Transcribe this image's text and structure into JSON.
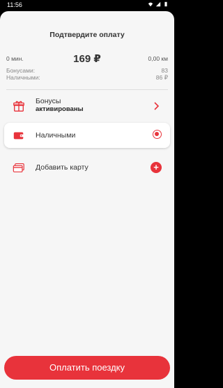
{
  "statusbar": {
    "time": "11:56"
  },
  "header": {
    "title": "Подтвердите оплату"
  },
  "summary": {
    "duration": "0 мин.",
    "price": "169 ₽",
    "distance": "0,00 км"
  },
  "balances": [
    {
      "label": "Бонусами:",
      "value": "83"
    },
    {
      "label": "Наличными:",
      "value": "86 ₽"
    }
  ],
  "payment": {
    "bonus": {
      "title": "Бонусы",
      "status": "активированы"
    },
    "cash": {
      "label": "Наличными",
      "selected": true
    },
    "card": {
      "label": "Добавить карту"
    }
  },
  "pay_button": {
    "label": "Оплатить поездку"
  },
  "colors": {
    "accent": "#e8333b",
    "background": "#f6f6f6"
  }
}
